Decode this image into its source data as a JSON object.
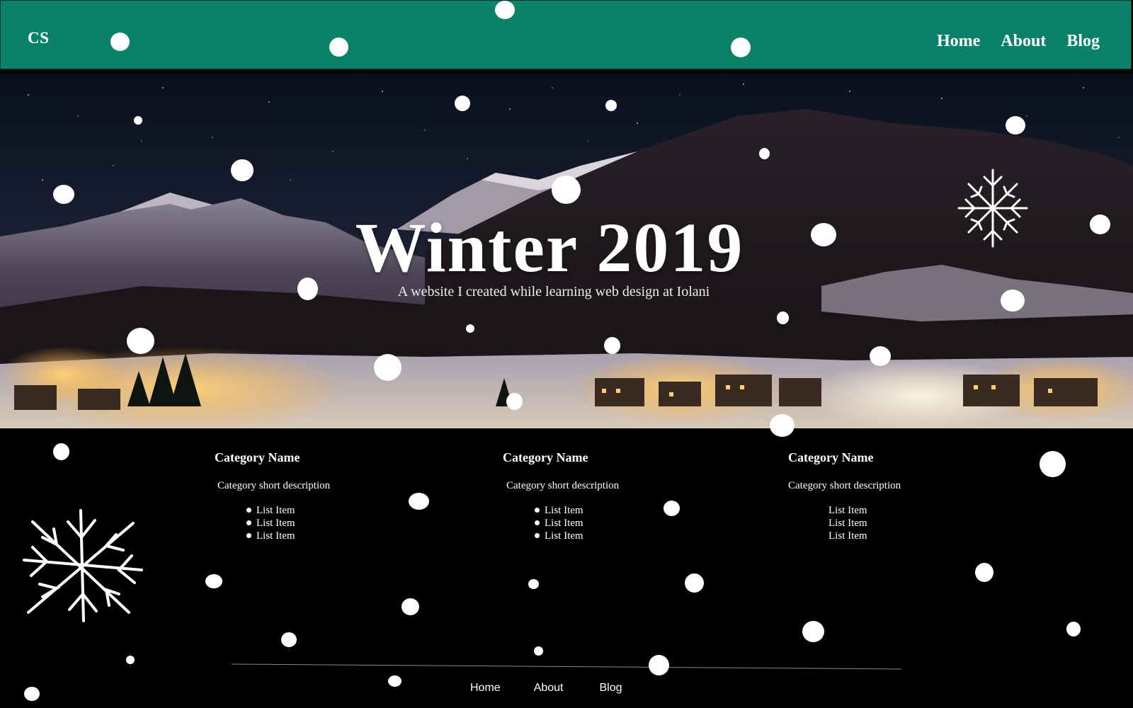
{
  "header": {
    "brand": "CS",
    "nav": [
      "Home",
      "About",
      "Blog"
    ]
  },
  "hero": {
    "title": "Winter 2019",
    "subtitle": "A website I created while learning web design at Iolani"
  },
  "categories": [
    {
      "title": "Category Name",
      "description": "Category short description",
      "items": [
        "List Item",
        "List Item",
        "List Item"
      ]
    },
    {
      "title": "Category Name",
      "description": "Category short description",
      "items": [
        "List Item",
        "List Item",
        "List Item"
      ]
    },
    {
      "title": "Category Name",
      "description": "Category short description",
      "items": [
        "List Item",
        "List Item",
        "List Item"
      ]
    }
  ],
  "footer": {
    "nav": [
      "Home",
      "About",
      "Blog"
    ]
  },
  "colors": {
    "header_bg": "#0b816a",
    "page_bg": "#000000",
    "text": "#ffffff"
  },
  "icons": {
    "snowflake": "snowflake-icon",
    "snowball": "snowball"
  }
}
